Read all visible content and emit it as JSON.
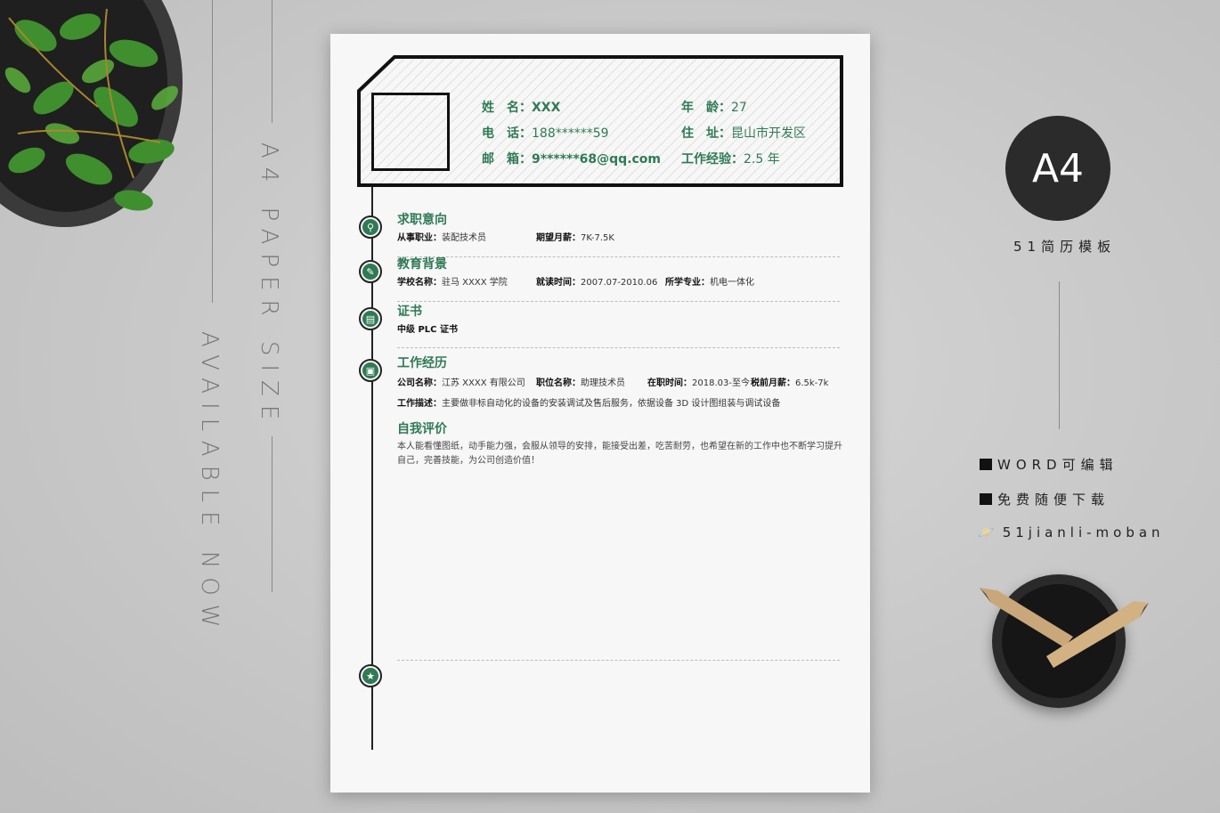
{
  "side": {
    "paper_size": "A4 PAPER SIZE",
    "available": "AVAILABLE NOW"
  },
  "brand": {
    "badge": "A4",
    "name": "51简历模板",
    "features": [
      "WORD可编辑",
      "免费随便下载"
    ],
    "site": "51jianli-moban"
  },
  "resume": {
    "info": {
      "name_label": "姓　名：",
      "name": "XXX",
      "phone_label": "电　话：",
      "phone": "188******59",
      "email_label": "邮　箱：",
      "email": "9******68@qq.com",
      "age_label": "年　龄：",
      "age": "27",
      "address_label": "住　址：",
      "address": "昆山市开发区",
      "experience_label": "工作经验：",
      "experience": "2.5 年"
    },
    "intent": {
      "title": "求职意向",
      "job_label": "从事职业：",
      "job": "装配技术员",
      "salary_label": "期望月薪：",
      "salary": "7K-7.5K"
    },
    "education": {
      "title": "教育背景",
      "school_label": "学校名称：",
      "school": "驻马 XXXX 学院",
      "period_label": "就读时间：",
      "period": "2007.07-2010.06",
      "major_label": "所学专业：",
      "major": "机电一体化"
    },
    "certificates": {
      "title": "证书",
      "item": "中级 PLC 证书"
    },
    "work": {
      "title": "工作经历",
      "company_label": "公司名称：",
      "company": "江苏 XXXX 有限公司",
      "position_label": "职位名称：",
      "position": "助理技术员",
      "tenure_label": "在职时间：",
      "tenure": "2018.03-至今",
      "pay_label": "税前月薪：",
      "pay": "6.5k-7k",
      "desc_label": "工作描述：",
      "desc": "主要做非标自动化的设备的安装调试及售后服务，依据设备 3D 设计图组装与调试设备"
    },
    "self": {
      "title": "自我评价",
      "text": "本人能看懂图纸，动手能力强，会服从领导的安排，能接受出差，吃苦耐劳，也希望在新的工作中也不断学习提升自己，完善技能，为公司创造价值！"
    }
  },
  "colors": {
    "accent": "#2f7a55",
    "badge_bg": "#2b2b2b"
  },
  "icons": [
    "person-icon",
    "graduation-icon",
    "document-icon",
    "briefcase-icon",
    "star-icon",
    "planet-icon"
  ]
}
